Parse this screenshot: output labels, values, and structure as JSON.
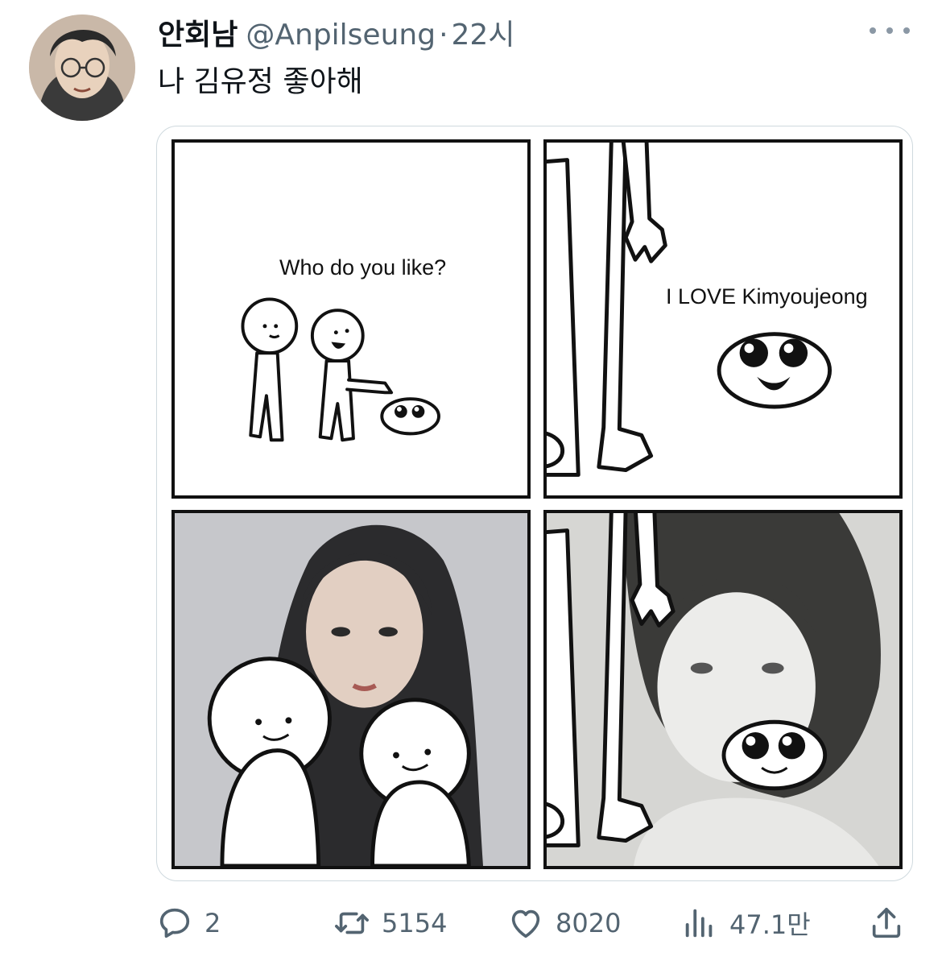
{
  "tweet": {
    "author_name": "안회남",
    "handle": "@Anpilseung",
    "separator": "·",
    "time": "22시",
    "text": "나 김유정 좋아해"
  },
  "comic": {
    "panel1_text": "Who do you like?",
    "panel2_text": "I LOVE Kimyoujeong"
  },
  "actions": {
    "replies": "2",
    "retweets": "5154",
    "likes": "8020",
    "views": "47.1만"
  },
  "icons": {
    "more": "more-icon",
    "reply": "reply-icon",
    "retweet": "retweet-icon",
    "like": "heart-icon",
    "views": "views-icon",
    "share": "share-icon"
  }
}
